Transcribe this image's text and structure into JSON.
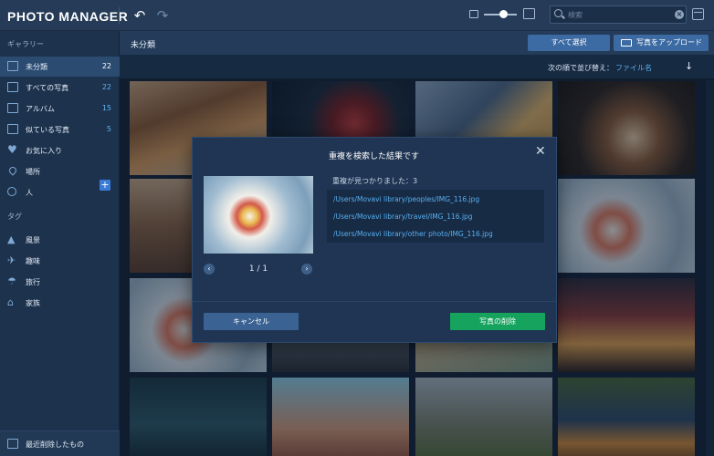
{
  "app": {
    "logo": "PHOTO MANAGER"
  },
  "toolbar": {
    "undo_icon": "undo-icon",
    "redo_icon": "redo-icon",
    "zoom_slider_level": 0.55,
    "search_placeholder": "検索"
  },
  "sidebar": {
    "gallery_label": "ギャラリー",
    "items": [
      {
        "label": "未分類",
        "count": "22",
        "icon": "folder-icon",
        "active": true
      },
      {
        "label": "すべての写真",
        "count": "22",
        "icon": "photos-icon"
      },
      {
        "label": "アルバム",
        "count": "15",
        "icon": "album-icon"
      },
      {
        "label": "似ている写真",
        "count": "5",
        "icon": "similar-icon"
      },
      {
        "label": "お気に入り",
        "count": "",
        "icon": "heart-icon"
      },
      {
        "label": "場所",
        "count": "",
        "icon": "location-pin-icon"
      },
      {
        "label": "人",
        "count": "",
        "icon": "person-icon"
      }
    ],
    "tags_label": "タグ",
    "tags": [
      {
        "label": "風景",
        "icon": "landscape-icon"
      },
      {
        "label": "趣味",
        "icon": "plane-icon"
      },
      {
        "label": "旅行",
        "icon": "umbrella-icon"
      },
      {
        "label": "家族",
        "icon": "house-icon"
      }
    ],
    "bottom_label": "最近削除したもの"
  },
  "main": {
    "title": "未分類",
    "select_all": "すべて選択",
    "upload": "写真をアップロード",
    "sort_label": "次の順で並び替え：",
    "sort_value": "ファイル名"
  },
  "dialog": {
    "title": "重複を検索した結果です",
    "pager": "1 / 1",
    "duplicates_found": "重複が見つかりました：3",
    "paths": [
      "/Users/Movavi library/peoples/IMG_116.jpg",
      "/Users/Movavi library/travel/IMG_116.jpg",
      "/Users/Movavi library/other photo/IMG_116.jpg"
    ],
    "cancel": "キャンセル",
    "delete": "写真の削除"
  },
  "colors": {
    "accent": "#3c6aa2",
    "link": "#59b0f0",
    "delete": "#15a35e",
    "active_row": "#2b4b71"
  }
}
